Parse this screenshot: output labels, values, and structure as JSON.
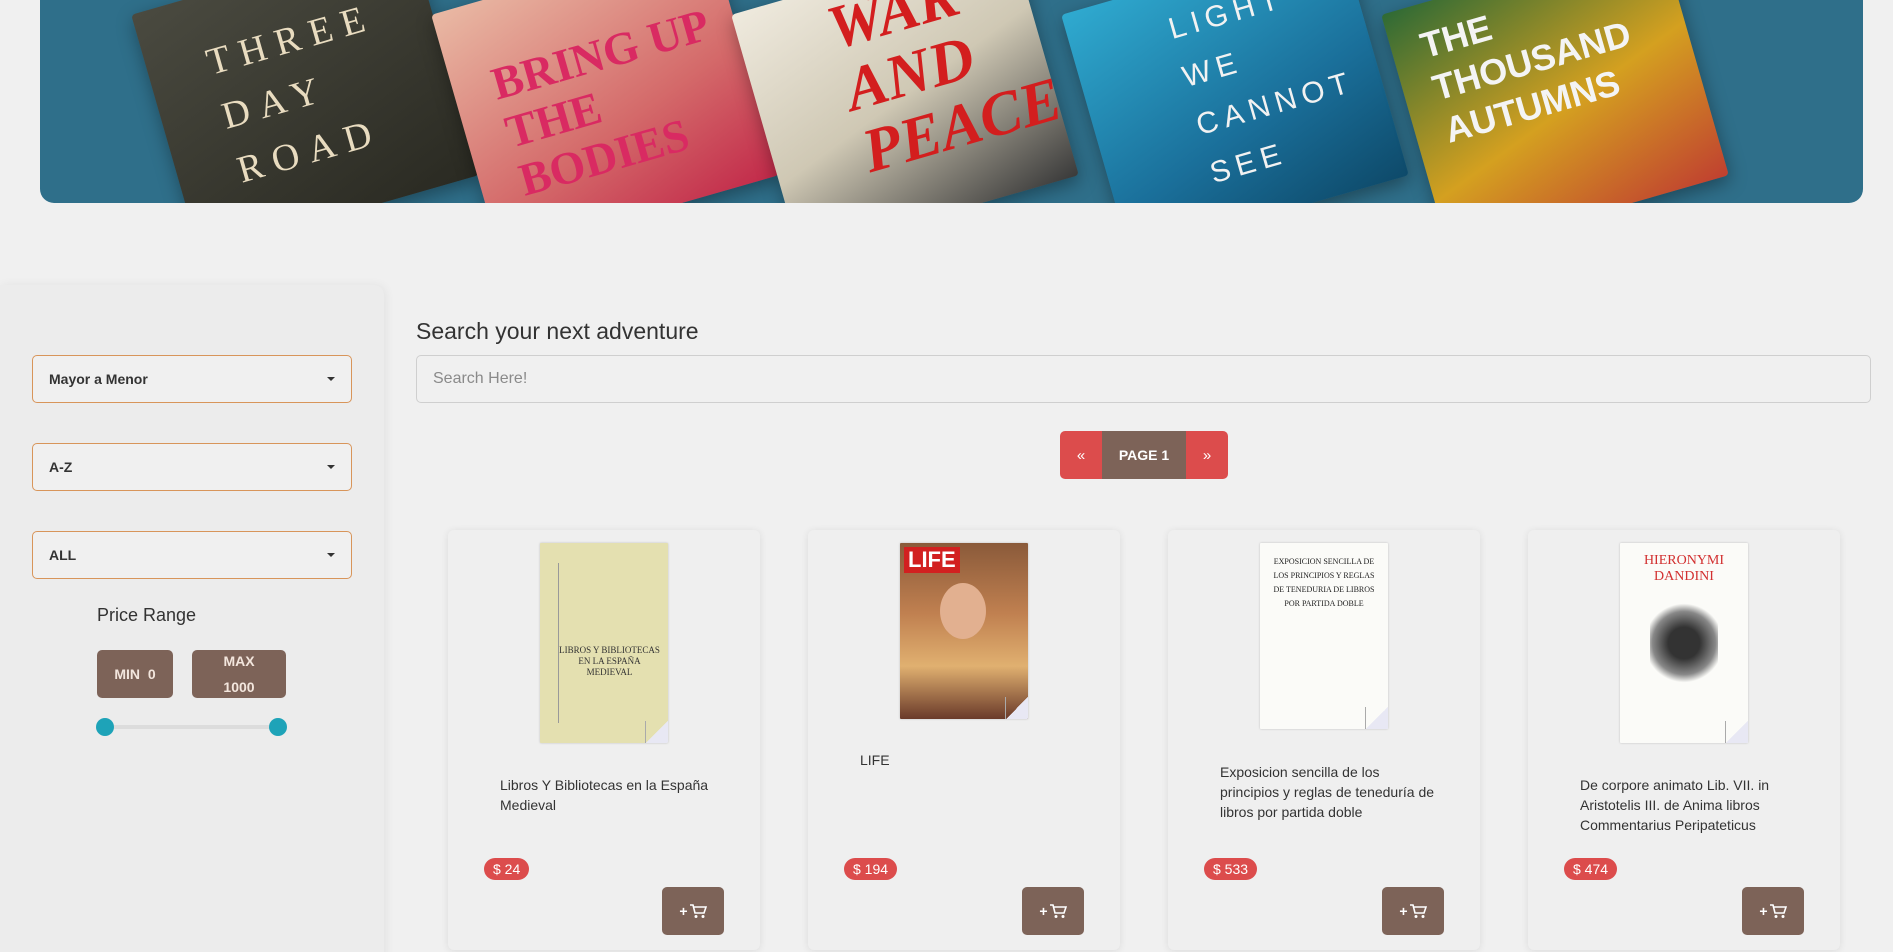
{
  "sidebar": {
    "sort_price": "Mayor a Menor",
    "sort_alpha": "A-Z",
    "category": "ALL",
    "price_range_title": "Price Range",
    "min_label": "MIN",
    "min_value": "0",
    "max_label": "MAX",
    "max_value": "1000",
    "slider_min_fraction": 0,
    "slider_max_fraction": 1
  },
  "search": {
    "title": "Search your next adventure",
    "placeholder": "Search Here!"
  },
  "pager": {
    "prev": "«",
    "page_label": "PAGE 1",
    "next": "»"
  },
  "colors": {
    "accent_red": "#dc4c4c",
    "brown": "#7d6358",
    "teal": "#1ea3b8",
    "select_border": "#d8955a"
  },
  "products": [
    {
      "title": "Libros Y Bibliotecas en la España Medieval",
      "price": "$ 24",
      "cart_label": "+"
    },
    {
      "title": "LIFE",
      "price": "$ 194",
      "cart_label": "+"
    },
    {
      "title": "Exposicion sencilla de los principios y reglas de teneduría de libros por partida doble",
      "price": "$ 533",
      "cart_label": "+"
    },
    {
      "title": "De corpore animato Lib. VII. in Aristotelis III. de Anima libros Commentarius Peripateticus",
      "price": "$ 474",
      "cart_label": "+"
    }
  ],
  "covers": {
    "c1": "THREE DAY ROAD",
    "c2": "BRING UP THE BODIES",
    "c3": "WAR AND PEACE",
    "c4": "LIGHT WE CANNOT SEE",
    "c5": "THE THOUSAND AUTUMNS",
    "p1": "LIBROS Y BIBLIOTECAS EN LA ESPAÑA MEDIEVAL",
    "p2": "LIFE",
    "p3": "EXPOSICION SENCILLA DE LOS PRINCIPIOS Y REGLAS DE TENEDURIA DE LIBROS POR PARTIDA DOBLE",
    "p4": "HIERONYMI DANDINI"
  }
}
